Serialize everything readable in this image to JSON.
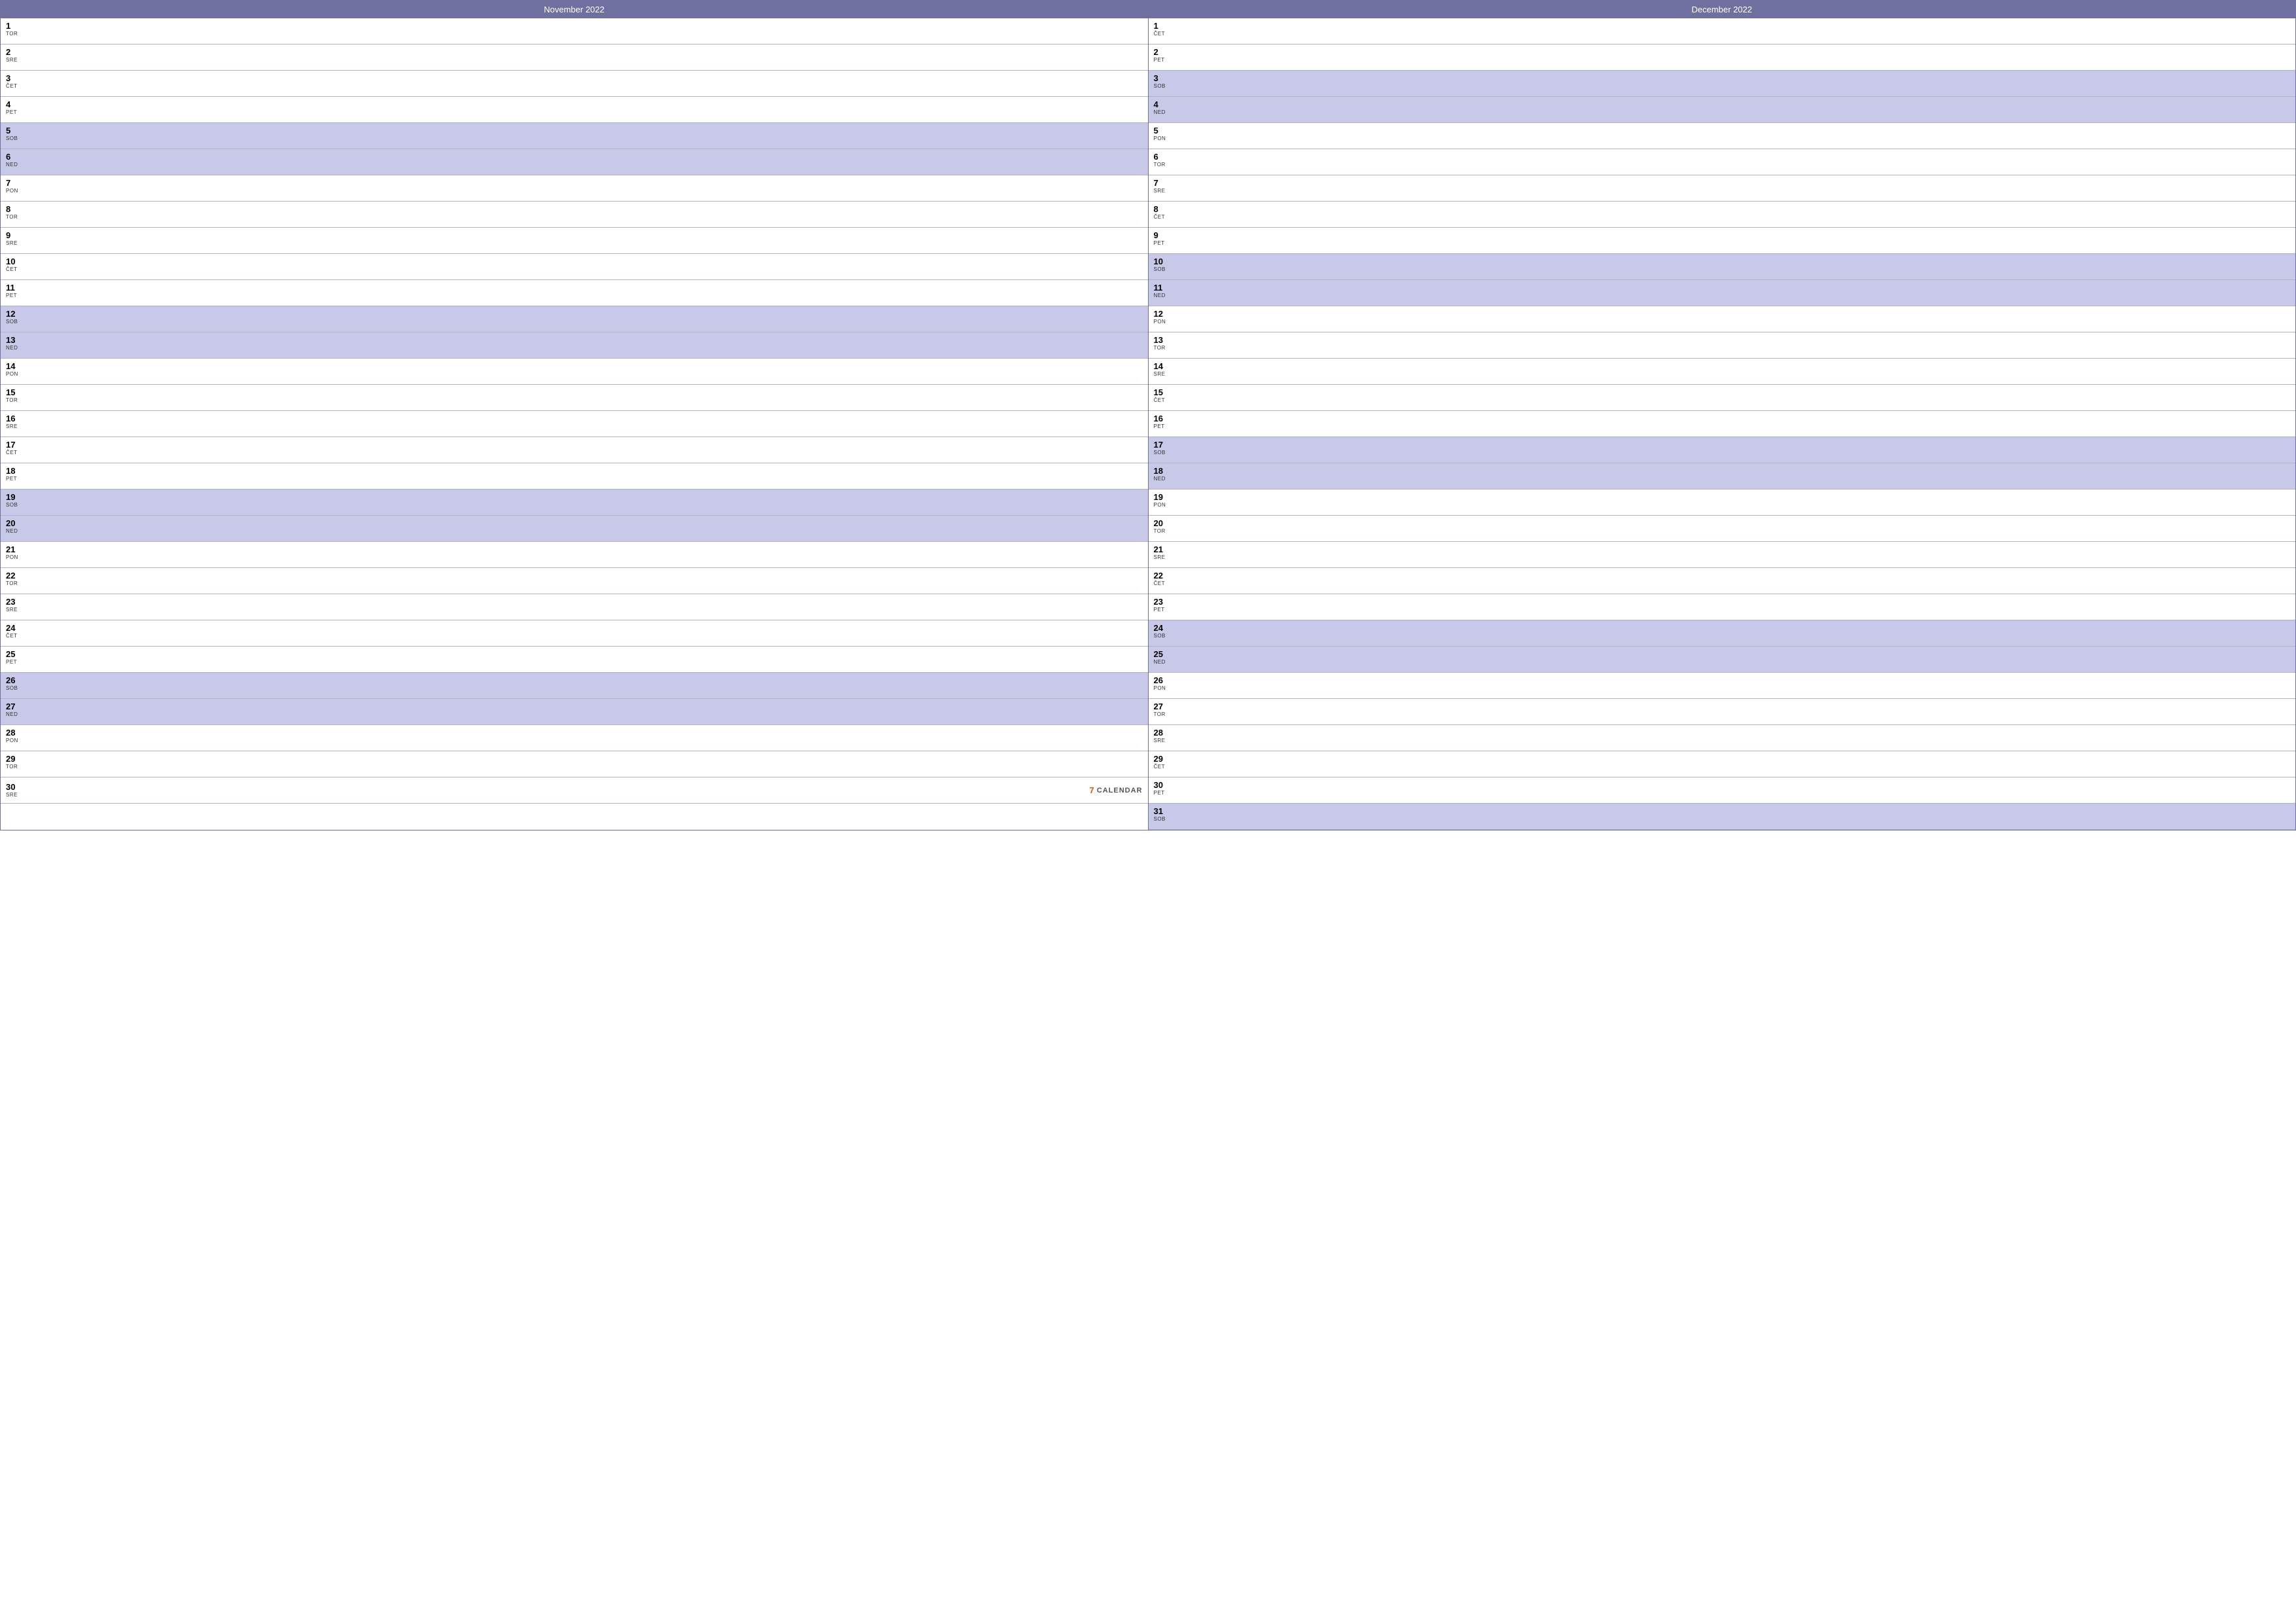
{
  "months": [
    {
      "id": "november-2022",
      "title": "November 2022",
      "days": [
        {
          "num": "1",
          "name": "TOR",
          "highlight": false
        },
        {
          "num": "2",
          "name": "SRE",
          "highlight": false
        },
        {
          "num": "3",
          "name": "ČET",
          "highlight": false
        },
        {
          "num": "4",
          "name": "PET",
          "highlight": false
        },
        {
          "num": "5",
          "name": "SOB",
          "highlight": true
        },
        {
          "num": "6",
          "name": "NED",
          "highlight": true
        },
        {
          "num": "7",
          "name": "PON",
          "highlight": false
        },
        {
          "num": "8",
          "name": "TOR",
          "highlight": false
        },
        {
          "num": "9",
          "name": "SRE",
          "highlight": false
        },
        {
          "num": "10",
          "name": "ČET",
          "highlight": false
        },
        {
          "num": "11",
          "name": "PET",
          "highlight": false
        },
        {
          "num": "12",
          "name": "SOB",
          "highlight": true
        },
        {
          "num": "13",
          "name": "NED",
          "highlight": true
        },
        {
          "num": "14",
          "name": "PON",
          "highlight": false
        },
        {
          "num": "15",
          "name": "TOR",
          "highlight": false
        },
        {
          "num": "16",
          "name": "SRE",
          "highlight": false
        },
        {
          "num": "17",
          "name": "ČET",
          "highlight": false
        },
        {
          "num": "18",
          "name": "PET",
          "highlight": false
        },
        {
          "num": "19",
          "name": "SOB",
          "highlight": true
        },
        {
          "num": "20",
          "name": "NED",
          "highlight": true
        },
        {
          "num": "21",
          "name": "PON",
          "highlight": false
        },
        {
          "num": "22",
          "name": "TOR",
          "highlight": false
        },
        {
          "num": "23",
          "name": "SRE",
          "highlight": false
        },
        {
          "num": "24",
          "name": "ČET",
          "highlight": false
        },
        {
          "num": "25",
          "name": "PET",
          "highlight": false
        },
        {
          "num": "26",
          "name": "SOB",
          "highlight": true
        },
        {
          "num": "27",
          "name": "NED",
          "highlight": true
        },
        {
          "num": "28",
          "name": "PON",
          "highlight": false
        },
        {
          "num": "29",
          "name": "TOR",
          "highlight": false
        },
        {
          "num": "30",
          "name": "SRE",
          "highlight": false
        }
      ]
    },
    {
      "id": "december-2022",
      "title": "December 2022",
      "days": [
        {
          "num": "1",
          "name": "ČET",
          "highlight": false
        },
        {
          "num": "2",
          "name": "PET",
          "highlight": false
        },
        {
          "num": "3",
          "name": "SOB",
          "highlight": true
        },
        {
          "num": "4",
          "name": "NED",
          "highlight": true
        },
        {
          "num": "5",
          "name": "PON",
          "highlight": false
        },
        {
          "num": "6",
          "name": "TOR",
          "highlight": false
        },
        {
          "num": "7",
          "name": "SRE",
          "highlight": false
        },
        {
          "num": "8",
          "name": "ČET",
          "highlight": false
        },
        {
          "num": "9",
          "name": "PET",
          "highlight": false
        },
        {
          "num": "10",
          "name": "SOB",
          "highlight": true
        },
        {
          "num": "11",
          "name": "NED",
          "highlight": true
        },
        {
          "num": "12",
          "name": "PON",
          "highlight": false
        },
        {
          "num": "13",
          "name": "TOR",
          "highlight": false
        },
        {
          "num": "14",
          "name": "SRE",
          "highlight": false
        },
        {
          "num": "15",
          "name": "ČET",
          "highlight": false
        },
        {
          "num": "16",
          "name": "PET",
          "highlight": false
        },
        {
          "num": "17",
          "name": "SOB",
          "highlight": true
        },
        {
          "num": "18",
          "name": "NED",
          "highlight": true
        },
        {
          "num": "19",
          "name": "PON",
          "highlight": false
        },
        {
          "num": "20",
          "name": "TOR",
          "highlight": false
        },
        {
          "num": "21",
          "name": "SRE",
          "highlight": false
        },
        {
          "num": "22",
          "name": "ČET",
          "highlight": false
        },
        {
          "num": "23",
          "name": "PET",
          "highlight": false
        },
        {
          "num": "24",
          "name": "SOB",
          "highlight": true
        },
        {
          "num": "25",
          "name": "NED",
          "highlight": true
        },
        {
          "num": "26",
          "name": "PON",
          "highlight": false
        },
        {
          "num": "27",
          "name": "TOR",
          "highlight": false
        },
        {
          "num": "28",
          "name": "SRE",
          "highlight": false
        },
        {
          "num": "29",
          "name": "ČET",
          "highlight": false
        },
        {
          "num": "30",
          "name": "PET",
          "highlight": false
        },
        {
          "num": "31",
          "name": "SOB",
          "highlight": true
        }
      ]
    }
  ],
  "watermark": {
    "logo": "7",
    "text": "CALENDAR"
  }
}
